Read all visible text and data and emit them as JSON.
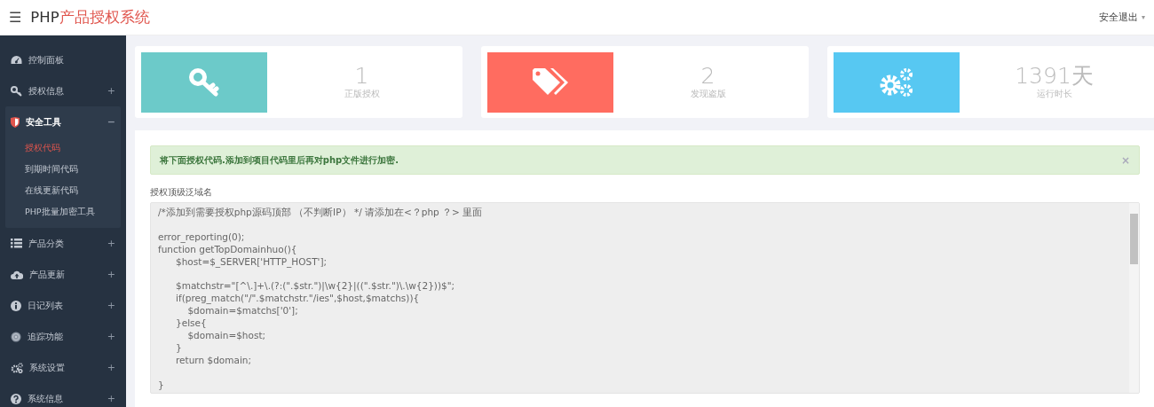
{
  "header": {
    "menu_icon": "☰",
    "title_prefix": "PHP",
    "title_main": "产品授权系统",
    "user_menu": "安全退出",
    "user_caret": "▾"
  },
  "sidebar": {
    "items": [
      {
        "label": "控制面板",
        "expanded": false
      },
      {
        "label": "授权信息",
        "expanded": false,
        "toggle": "+"
      },
      {
        "label": "安全工具",
        "expanded": true,
        "toggle": "−",
        "children": [
          {
            "label": "授权代码",
            "selected": true
          },
          {
            "label": "到期时间代码",
            "selected": false
          },
          {
            "label": "在线更新代码",
            "selected": false
          },
          {
            "label": "PHP批量加密工具",
            "selected": false
          }
        ]
      },
      {
        "label": "产品分类",
        "expanded": false,
        "toggle": "+"
      },
      {
        "label": "产品更新",
        "expanded": false,
        "toggle": "+"
      },
      {
        "label": "日记列表",
        "expanded": false,
        "toggle": "+"
      },
      {
        "label": "追踪功能",
        "expanded": false,
        "toggle": "+"
      },
      {
        "label": "系统设置",
        "expanded": false,
        "toggle": "+"
      },
      {
        "label": "系统信息",
        "expanded": false,
        "toggle": "+"
      }
    ]
  },
  "stats": [
    {
      "color": "#6ccac9",
      "value": "1",
      "label": "正版授权"
    },
    {
      "color": "#ff6c60",
      "value": "2",
      "label": "发现盗版"
    },
    {
      "color": "#57c8f2",
      "value": "1391天",
      "label": "运行时长"
    }
  ],
  "alert": {
    "message": "将下面授权代码.添加到项目代码里后再对php文件进行加密.",
    "close": "×"
  },
  "code_section": {
    "label": "授权顶级泛域名",
    "code": "/*添加到需要授权php源码顶部 （不判断IP） */ 请添加在<？php ？> 里面\n\nerror_reporting(0);\nfunction getTopDomainhuo(){\n\t$host=$_SERVER['HTTP_HOST'];\n\n\t$matchstr=\"[^\\.]+\\.(?:(\".$str.\")|\\w{2}|((\".$str.\")\\.\\w{2}))$\";\n\tif(preg_match(\"/\".$matchstr.\"/ies\",$host,$matchs)){\n\t    $domain=$matchs['0'];\n\t}else{\n\t    $domain=$host;\n\t}\n\treturn $domain;\n\n}"
  }
}
